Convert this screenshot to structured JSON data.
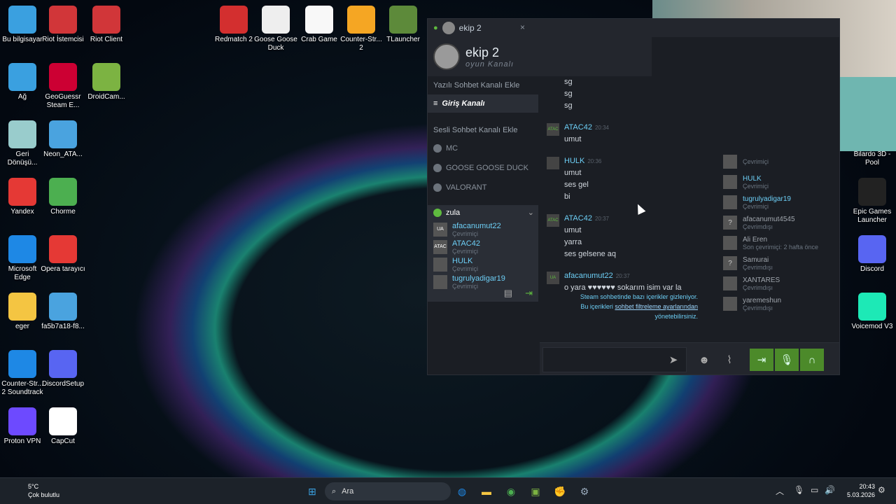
{
  "desktop_icons": [
    {
      "label": "Bu bilgisayar",
      "icon": "monitor-icon",
      "color": "#3aa0e0"
    },
    {
      "label": "Riot İstemcisi",
      "icon": "riot-fist-icon",
      "color": "#d13639"
    },
    {
      "label": "Riot Client",
      "icon": "riot-fist-icon",
      "color": "#d13639"
    },
    {
      "label": "Ağ",
      "icon": "network-icon",
      "color": "#3aa0e0"
    },
    {
      "label": "GeoGuessr Steam E...",
      "icon": "map-pin-icon",
      "color": "#c03"
    },
    {
      "label": "DroidCam...",
      "icon": "android-icon",
      "color": "#7cb342"
    },
    {
      "label": "Geri Dönüşü...",
      "icon": "recycle-bin-icon",
      "color": "#9cc"
    },
    {
      "label": "Neon_ATA...",
      "icon": "image-file-icon",
      "color": "#4aa3df"
    },
    {
      "label": "Yandex",
      "icon": "yandex-icon",
      "color": "#e53935"
    },
    {
      "label": "Chorme",
      "icon": "chrome-icon",
      "color": "#4caf50"
    },
    {
      "label": "Microsoft Edge",
      "icon": "edge-icon",
      "color": "#1e88e5"
    },
    {
      "label": "Opera tarayıcı",
      "icon": "opera-icon",
      "color": "#e53935"
    },
    {
      "label": "eger",
      "icon": "folder-icon",
      "color": "#f4c542"
    },
    {
      "label": "fa5b7a18-f8...",
      "icon": "image-file-icon",
      "color": "#4aa3df"
    },
    {
      "label": "Counter-Str... 2 Soundtrack",
      "icon": "music-icon",
      "color": "#1e88e5"
    },
    {
      "label": "DiscordSetup",
      "icon": "discord-icon",
      "color": "#5865f2"
    },
    {
      "label": "Proton VPN",
      "icon": "proton-vpn-icon",
      "color": "#6d4aff"
    },
    {
      "label": "CapCut",
      "icon": "capcut-icon",
      "color": "#ffffff"
    },
    {
      "label": "Redmatch 2",
      "icon": "r2-icon",
      "color": "#d32f2f"
    },
    {
      "label": "Goose Goose Duck",
      "icon": "goose-icon",
      "color": "#eeeeee"
    },
    {
      "label": "Crab Game",
      "icon": "crab-game-icon",
      "color": "#f8f8f8"
    },
    {
      "label": "Counter-Str... 2",
      "icon": "cs2-icon",
      "color": "#f5a623"
    },
    {
      "label": "TLauncher",
      "icon": "minecraft-icon",
      "color": "#5d8a3a"
    },
    {
      "label": "Bilardo 3D - Pool",
      "icon": "pool-icon",
      "color": "#2e7d32"
    },
    {
      "label": "Epic Games Launcher",
      "icon": "epic-games-icon",
      "color": "#222222"
    },
    {
      "label": "Discord",
      "icon": "discord-icon",
      "color": "#5865f2"
    },
    {
      "label": "Voicemod V3",
      "icon": "voicemod-icon",
      "color": "#1de9b6"
    }
  ],
  "chat": {
    "window_title": "ekip 2",
    "close_glyph": "×",
    "group_name": "ekip 2",
    "group_sub": "oyun Kanalı",
    "text_channel_add": "Yazılı Sohbet Kanalı Ekle",
    "text_channel": "Giriş Kanalı",
    "voice_channel_add": "Sesli Sohbet Kanalı Ekle",
    "voice_channels": [
      "MC",
      "GOOSE GOOSE DUCK",
      "VALORANT"
    ],
    "active_voice": {
      "name": "zula",
      "members": [
        {
          "name": "afacanumut22",
          "status": "Çevrimiçi",
          "badge": "UA"
        },
        {
          "name": "ATAC42",
          "status": "Çevrimiçi",
          "badge": "ATAC"
        },
        {
          "name": "HULK",
          "status": "Çevrimiçi",
          "badge": ""
        },
        {
          "name": "tugrulyadigar19",
          "status": "Çevrimiçi",
          "badge": ""
        }
      ]
    },
    "messages": [
      {
        "type": "line",
        "text": "sg"
      },
      {
        "type": "line",
        "text": "sg"
      },
      {
        "type": "line",
        "text": "sg"
      },
      {
        "type": "sender",
        "name": "ATAC42",
        "time": "20:34",
        "badge": "ATAC"
      },
      {
        "type": "line",
        "text": "umut"
      },
      {
        "type": "sender",
        "name": "HULK",
        "time": "20:36",
        "badge": ""
      },
      {
        "type": "line",
        "text": "umut"
      },
      {
        "type": "line",
        "text": "ses gel"
      },
      {
        "type": "line",
        "text": "bi"
      },
      {
        "type": "sender",
        "name": "ATAC42",
        "time": "20:37",
        "badge": "ATAC"
      },
      {
        "type": "line",
        "text": "umut"
      },
      {
        "type": "line",
        "text": "yarra"
      },
      {
        "type": "line",
        "text": "ses gelsene aq"
      },
      {
        "type": "sender",
        "name": "afacanumut22",
        "time": "20:37",
        "badge": "UA"
      },
      {
        "type": "line",
        "text": "o yara ♥♥♥♥♥♥ sokarım isim var la"
      }
    ],
    "filter_note_1": "Steam sohbetinde bazı içerikler gizleniyor.",
    "filter_note_2": "Bu içerikleri",
    "filter_note_link": "sohbet filtreleme ayarlarından",
    "filter_note_3": "yönetebilirsiniz.",
    "members_list": [
      {
        "name": "",
        "status": "Çevrimiçi",
        "online": true
      },
      {
        "name": "HULK",
        "status": "Çevrimiçi",
        "online": true
      },
      {
        "name": "tugrulyadigar19",
        "status": "Çevrimiçi",
        "online": true
      },
      {
        "name": "afacanumut4545",
        "status": "Çevrimdışı",
        "online": false,
        "avatar": "?"
      },
      {
        "name": "Ali Eren",
        "status": "Son çevrimiçi: 2 hafta önce",
        "online": false
      },
      {
        "name": "Samurai",
        "status": "Çevrimdışı",
        "online": false,
        "avatar": "?"
      },
      {
        "name": "XANTARES",
        "status": "Çevrimdışı",
        "online": false
      },
      {
        "name": "yaremeshun",
        "status": "Çevrimdışı",
        "online": false
      }
    ],
    "input_placeholder": ""
  },
  "taskbar": {
    "weather_temp": "5°C",
    "weather_desc": "Çok bulutlu",
    "search_label": "Ara",
    "time": "20:43",
    "date": "5.03.2026"
  }
}
